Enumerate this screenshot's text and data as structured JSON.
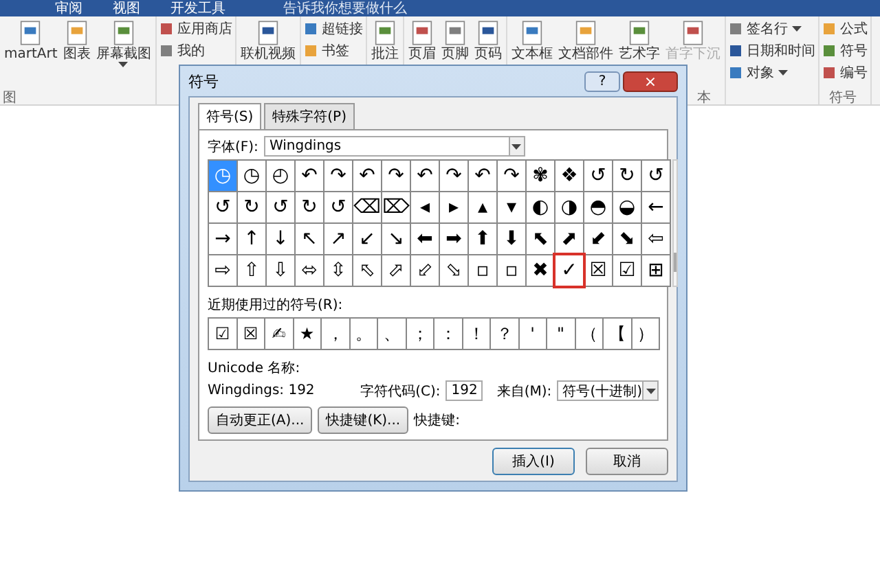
{
  "ribbon": {
    "tabs": [
      {
        "label": "审阅"
      },
      {
        "label": "视图"
      },
      {
        "label": "开发工具"
      }
    ],
    "tell_me": "告诉我你想要做什么",
    "groups": [
      {
        "label": "图",
        "items": [
          {
            "kind": "large",
            "label": "martArt"
          },
          {
            "kind": "large",
            "label": "图表"
          },
          {
            "kind": "large",
            "label": "屏幕截图",
            "dropdown": true
          }
        ]
      },
      {
        "items": [
          {
            "kind": "small",
            "label": "应用商店"
          },
          {
            "kind": "small",
            "label": "我的"
          }
        ]
      },
      {
        "items": [
          {
            "kind": "large",
            "label": "联机视频"
          }
        ]
      },
      {
        "items": [
          {
            "kind": "small",
            "label": "超链接"
          },
          {
            "kind": "small",
            "label": "书签"
          }
        ]
      },
      {
        "items": [
          {
            "kind": "large",
            "label": "批注"
          }
        ]
      },
      {
        "items": [
          {
            "kind": "large",
            "label": "页眉"
          },
          {
            "kind": "large",
            "label": "页脚"
          },
          {
            "kind": "large",
            "label": "页码"
          }
        ]
      },
      {
        "label": "本",
        "items": [
          {
            "kind": "large",
            "label": "文本框"
          },
          {
            "kind": "large",
            "label": "文档部件"
          },
          {
            "kind": "large",
            "label": "艺术字"
          },
          {
            "kind": "large",
            "label": "首字下沉",
            "disabled": true
          }
        ]
      },
      {
        "items": [
          {
            "kind": "small",
            "label": "签名行",
            "dropdown": true
          },
          {
            "kind": "small",
            "label": "日期和时间"
          },
          {
            "kind": "small",
            "label": "对象",
            "dropdown": true
          }
        ]
      },
      {
        "label": "符号",
        "items": [
          {
            "kind": "small",
            "label": "公式"
          },
          {
            "kind": "small",
            "label": "符号"
          },
          {
            "kind": "small",
            "label": "编号"
          }
        ]
      }
    ]
  },
  "dialog": {
    "title": "符号",
    "help": "?",
    "close": "×",
    "tabs": [
      {
        "label": "符号(S)",
        "selected": true
      },
      {
        "label": "特殊字符(P)",
        "selected": false
      }
    ],
    "font_label": "字体(F):",
    "font": "Wingdings",
    "grid": [
      [
        {
          "symbol": "◷",
          "selected": true,
          "marked": false
        },
        {
          "symbol": "◷",
          "selected": false,
          "marked": false
        },
        {
          "symbol": "◴",
          "selected": false,
          "marked": false
        },
        {
          "symbol": "↶",
          "selected": false,
          "marked": false
        },
        {
          "symbol": "↷",
          "selected": false,
          "marked": false
        },
        {
          "symbol": "↶",
          "selected": false,
          "marked": false
        },
        {
          "symbol": "↷",
          "selected": false,
          "marked": false
        },
        {
          "symbol": "↶",
          "selected": false,
          "marked": false
        },
        {
          "symbol": "↷",
          "selected": false,
          "marked": false
        },
        {
          "symbol": "↶",
          "selected": false,
          "marked": false
        },
        {
          "symbol": "↷",
          "selected": false,
          "marked": false
        },
        {
          "symbol": "✾",
          "selected": false,
          "marked": false
        },
        {
          "symbol": "❖",
          "selected": false,
          "marked": false
        },
        {
          "symbol": "↺",
          "selected": false,
          "marked": false
        },
        {
          "symbol": "↻",
          "selected": false,
          "marked": false
        },
        {
          "symbol": "↺",
          "selected": false,
          "marked": false
        }
      ],
      [
        {
          "symbol": "↺",
          "selected": false,
          "marked": false
        },
        {
          "symbol": "↻",
          "selected": false,
          "marked": false
        },
        {
          "symbol": "↺",
          "selected": false,
          "marked": false
        },
        {
          "symbol": "↻",
          "selected": false,
          "marked": false
        },
        {
          "symbol": "↺",
          "selected": false,
          "marked": false
        },
        {
          "symbol": "⌫",
          "selected": false,
          "marked": false
        },
        {
          "symbol": "⌦",
          "selected": false,
          "marked": false
        },
        {
          "symbol": "◂",
          "selected": false,
          "marked": false
        },
        {
          "symbol": "▸",
          "selected": false,
          "marked": false
        },
        {
          "symbol": "▴",
          "selected": false,
          "marked": false
        },
        {
          "symbol": "▾",
          "selected": false,
          "marked": false
        },
        {
          "symbol": "◐",
          "selected": false,
          "marked": false
        },
        {
          "symbol": "◑",
          "selected": false,
          "marked": false
        },
        {
          "symbol": "◓",
          "selected": false,
          "marked": false
        },
        {
          "symbol": "◒",
          "selected": false,
          "marked": false
        },
        {
          "symbol": "←",
          "selected": false,
          "marked": false
        }
      ],
      [
        {
          "symbol": "→",
          "selected": false,
          "marked": false
        },
        {
          "symbol": "↑",
          "selected": false,
          "marked": false
        },
        {
          "symbol": "↓",
          "selected": false,
          "marked": false
        },
        {
          "symbol": "↖",
          "selected": false,
          "marked": false
        },
        {
          "symbol": "↗",
          "selected": false,
          "marked": false
        },
        {
          "symbol": "↙",
          "selected": false,
          "marked": false
        },
        {
          "symbol": "↘",
          "selected": false,
          "marked": false
        },
        {
          "symbol": "⬅",
          "selected": false,
          "marked": false
        },
        {
          "symbol": "➡",
          "selected": false,
          "marked": false
        },
        {
          "symbol": "⬆",
          "selected": false,
          "marked": false
        },
        {
          "symbol": "⬇",
          "selected": false,
          "marked": false
        },
        {
          "symbol": "⬉",
          "selected": false,
          "marked": false
        },
        {
          "symbol": "⬈",
          "selected": false,
          "marked": false
        },
        {
          "symbol": "⬋",
          "selected": false,
          "marked": false
        },
        {
          "symbol": "⬊",
          "selected": false,
          "marked": false
        },
        {
          "symbol": "⇦",
          "selected": false,
          "marked": false
        }
      ],
      [
        {
          "symbol": "⇨",
          "selected": false,
          "marked": false
        },
        {
          "symbol": "⇧",
          "selected": false,
          "marked": false
        },
        {
          "symbol": "⇩",
          "selected": false,
          "marked": false
        },
        {
          "symbol": "⬄",
          "selected": false,
          "marked": false
        },
        {
          "symbol": "⇳",
          "selected": false,
          "marked": false
        },
        {
          "symbol": "⬁",
          "selected": false,
          "marked": false
        },
        {
          "symbol": "⬀",
          "selected": false,
          "marked": false
        },
        {
          "symbol": "⬃",
          "selected": false,
          "marked": false
        },
        {
          "symbol": "⬂",
          "selected": false,
          "marked": false
        },
        {
          "symbol": "▫",
          "selected": false,
          "marked": false
        },
        {
          "symbol": "▫",
          "selected": false,
          "marked": false
        },
        {
          "symbol": "✖",
          "selected": false,
          "marked": false
        },
        {
          "symbol": "✓",
          "selected": false,
          "marked": true
        },
        {
          "symbol": "☒",
          "selected": false,
          "marked": false
        },
        {
          "symbol": "☑",
          "selected": false,
          "marked": false
        },
        {
          "symbol": "⊞",
          "selected": false,
          "marked": false
        }
      ]
    ],
    "recent_label": "近期使用过的符号(R):",
    "recent": [
      "☑",
      "☒",
      "✍",
      "★",
      "，",
      "。",
      "、",
      "；",
      "：",
      "！",
      "？",
      "'",
      "\"",
      "（",
      "【",
      "）"
    ],
    "unicode_label": "Unicode 名称:",
    "unicode_value": "Wingdings: 192",
    "code_label": "字符代码(C):",
    "code": "192",
    "from_label": "来自(M):",
    "from": "符号(十进制)",
    "autocorrect_button": "自动更正(A)...",
    "shortcut_button": "快捷键(K)...",
    "shortcut_label": "快捷键:",
    "insert_button": "插入(I)",
    "cancel_button": "取消"
  }
}
